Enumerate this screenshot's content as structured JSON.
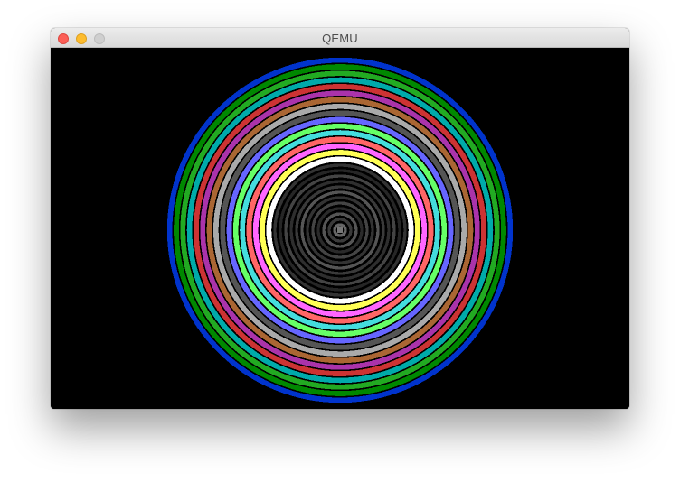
{
  "window": {
    "title": "QEMU"
  },
  "display": {
    "background": "#000000",
    "rings": [
      "#0033cc",
      "#008800",
      "#22aa22",
      "#00aaaa",
      "#cc3333",
      "#aa33aa",
      "#aa6633",
      "#aaaaaa",
      "#555555",
      "#6666ff",
      "#66ff66",
      "#44dddd",
      "#ff6666",
      "#ff66ff",
      "#ffff55",
      "#ffffff"
    ],
    "inner_rings": [
      "#333333",
      "#262626",
      "#444444",
      "#2e2e2e",
      "#3a3a3a",
      "#555555",
      "#333333",
      "#444444",
      "#2a2a2a",
      "#555555",
      "#3a3a3a",
      "#666666"
    ]
  }
}
